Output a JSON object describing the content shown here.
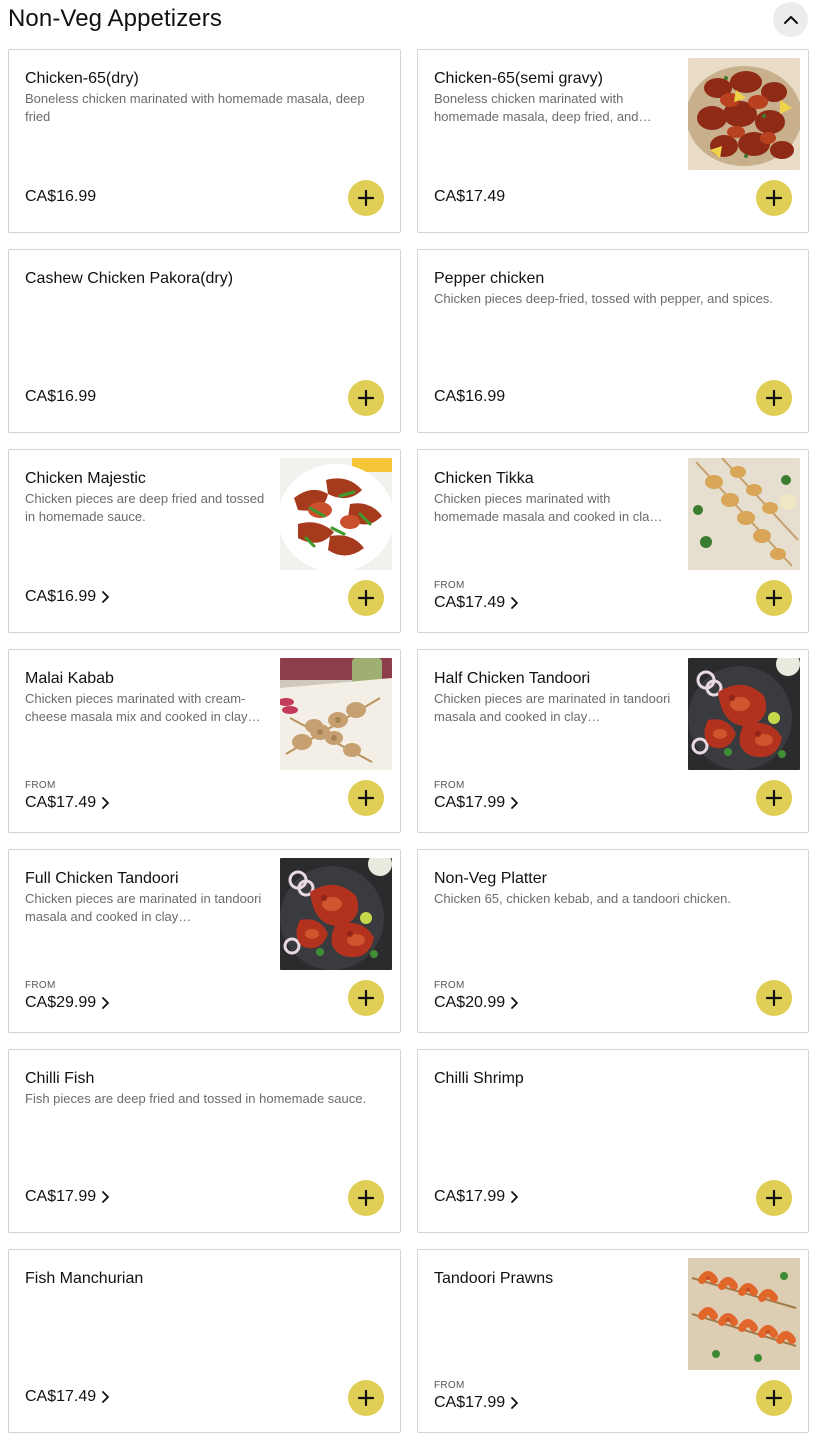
{
  "section": {
    "title": "Non-Veg Appetizers"
  },
  "colors": {
    "add_button": "#dfcf56",
    "card_border": "#d3d3d3",
    "collapse_bg": "#ececec"
  },
  "items": [
    {
      "name": "Chicken-65(dry)",
      "description": "Boneless chicken marinated with homemade masala, deep fried",
      "from": "",
      "price": "CA$16.99",
      "chevron": false,
      "image": ""
    },
    {
      "name": "Chicken-65(semi gravy)",
      "description": "Boneless chicken marinated with homemade masala, deep fried, and…",
      "from": "",
      "price": "CA$17.49",
      "chevron": false,
      "image": "fried-chicken-photo"
    },
    {
      "name": "Cashew Chicken Pakora(dry)",
      "description": "",
      "from": "",
      "price": "CA$16.99",
      "chevron": false,
      "image": ""
    },
    {
      "name": "Pepper chicken",
      "description": "Chicken pieces deep-fried, tossed with pepper, and spices.",
      "from": "",
      "price": "CA$16.99",
      "chevron": false,
      "image": ""
    },
    {
      "name": "Chicken Majestic",
      "description": "Chicken pieces are deep fried and tossed in homemade sauce.",
      "from": "",
      "price": "CA$16.99",
      "chevron": true,
      "image": "chicken-majestic-photo"
    },
    {
      "name": "Chicken Tikka",
      "description": "Chicken pieces marinated with homemade masala and cooked in cla…",
      "from": "FROM",
      "price": "CA$17.49",
      "chevron": true,
      "image": "tikka-skewers-photo"
    },
    {
      "name": "Malai Kabab",
      "description": "Chicken pieces marinated with cream-cheese masala mix and cooked in clay…",
      "from": "FROM",
      "price": "CA$17.49",
      "chevron": true,
      "image": "malai-kabab-photo"
    },
    {
      "name": "Half Chicken Tandoori",
      "description": "Chicken pieces are marinated in tandoori masala and cooked in clay…",
      "from": "FROM",
      "price": "CA$17.99",
      "chevron": true,
      "image": "tandoori-chicken-photo"
    },
    {
      "name": "Full Chicken Tandoori",
      "description": "Chicken pieces are marinated in tandoori masala and cooked in clay…",
      "from": "FROM",
      "price": "CA$29.99",
      "chevron": true,
      "image": "tandoori-chicken-photo"
    },
    {
      "name": "Non-Veg Platter",
      "description": "Chicken 65, chicken kebab, and a tandoori chicken.",
      "from": "FROM",
      "price": "CA$20.99",
      "chevron": true,
      "image": ""
    },
    {
      "name": "Chilli Fish",
      "description": "Fish pieces are deep fried and tossed in homemade sauce.",
      "from": "",
      "price": "CA$17.99",
      "chevron": true,
      "image": ""
    },
    {
      "name": "Chilli Shrimp",
      "description": "",
      "from": "",
      "price": "CA$17.99",
      "chevron": true,
      "image": ""
    },
    {
      "name": "Fish Manchurian",
      "description": "",
      "from": "",
      "price": "CA$17.49",
      "chevron": true,
      "image": ""
    },
    {
      "name": "Tandoori Prawns",
      "description": "",
      "from": "FROM",
      "price": "CA$17.99",
      "chevron": true,
      "image": "tandoori-prawns-photo"
    }
  ]
}
